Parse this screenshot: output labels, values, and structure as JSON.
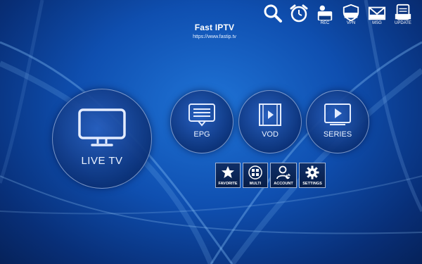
{
  "brand": {
    "title": "Fast IPTV",
    "url": "https://www.fastip.tv"
  },
  "top_icons": [
    {
      "name": "search-icon",
      "label": ""
    },
    {
      "name": "alarm-clock-icon",
      "label": ""
    },
    {
      "name": "record-icon",
      "label": "REC"
    },
    {
      "name": "vpn-icon",
      "label": "VPN"
    },
    {
      "name": "message-icon",
      "label": "MSG"
    },
    {
      "name": "update-icon",
      "label": "UPDATE"
    }
  ],
  "tiles": {
    "live_tv": "LIVE TV",
    "epg": "EPG",
    "vod": "VOD",
    "series": "SERIES"
  },
  "small_buttons": {
    "favorite": "FAVORITE",
    "multi": "MULTI",
    "account": "ACCOUNT",
    "settings": "SETTINGS"
  },
  "colors": {
    "background": "#0f4fb0",
    "tile_border": "#d2e1ff"
  }
}
